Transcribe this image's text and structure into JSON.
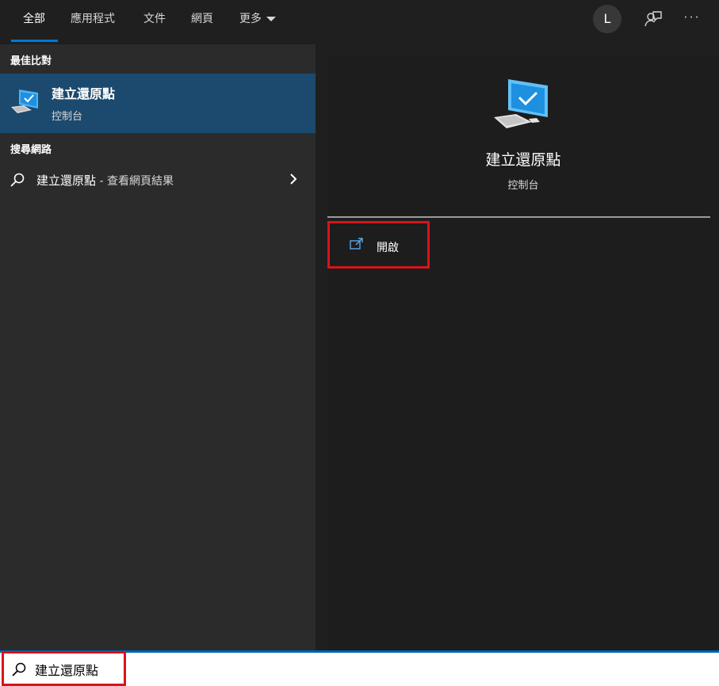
{
  "tabs": [
    {
      "label": "全部",
      "active": true
    },
    {
      "label": "應用程式"
    },
    {
      "label": "文件"
    },
    {
      "label": "網頁"
    },
    {
      "label": "更多"
    }
  ],
  "user": {
    "avatar_letter": "L"
  },
  "icons": {
    "feedback": "feedback-icon",
    "more": "more-options-icon",
    "search": "search-icon",
    "open": "open-in-new-icon"
  },
  "more_glyph": "···",
  "colors": {
    "accent": "#0078d7",
    "selected_bg": "#1c4a6e",
    "highlight_box": "#d7141b"
  },
  "left": {
    "best_match_label": "最佳比對",
    "best_item": {
      "title": "建立還原點",
      "subtitle": "控制台"
    },
    "web_label": "搜尋網路",
    "web_item": {
      "query": "建立還原點",
      "suffix": " - 查看網頁結果"
    }
  },
  "right": {
    "title": "建立還原點",
    "subtitle": "控制台",
    "actions": [
      {
        "label": "開啟"
      }
    ]
  },
  "search": {
    "value": "建立還原點"
  }
}
